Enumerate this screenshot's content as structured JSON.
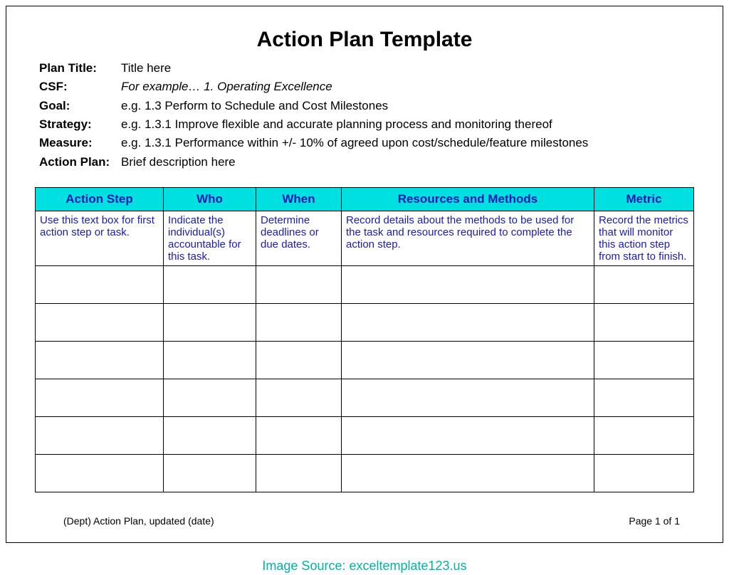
{
  "title": "Action Plan Template",
  "meta": [
    {
      "label": "Plan Title:",
      "value": "Title here"
    },
    {
      "label": "CSF:",
      "value": "For example… 1. Operating Excellence",
      "italic": true
    },
    {
      "label": "Goal:",
      "value": "e.g. 1.3  Perform to Schedule and Cost Milestones"
    },
    {
      "label": "Strategy:",
      "value": "e.g. 1.3.1  Improve flexible and accurate planning process and monitoring thereof"
    },
    {
      "label": "Measure:",
      "value": "e.g. 1.3.1  Performance within +/- 10% of agreed upon cost/schedule/feature milestones"
    },
    {
      "label": "Action Plan:",
      "value": "Brief description here"
    }
  ],
  "headers": [
    "Action Step",
    "Who",
    "When",
    "Resources and Methods",
    "Metric"
  ],
  "descRow": [
    "Use this text box for first action step or task.",
    "Indicate the individual(s) accountable for this task.",
    "Determine deadlines or due dates.",
    "Record details about the methods to be used for the task and resources required to complete the action step.",
    "Record the metrics that will monitor this action step from start to finish."
  ],
  "footerLeft": "(Dept) Action Plan, updated (date)",
  "footerRight": "Page 1 of 1",
  "source": "Image Source: exceltemplate123.us"
}
